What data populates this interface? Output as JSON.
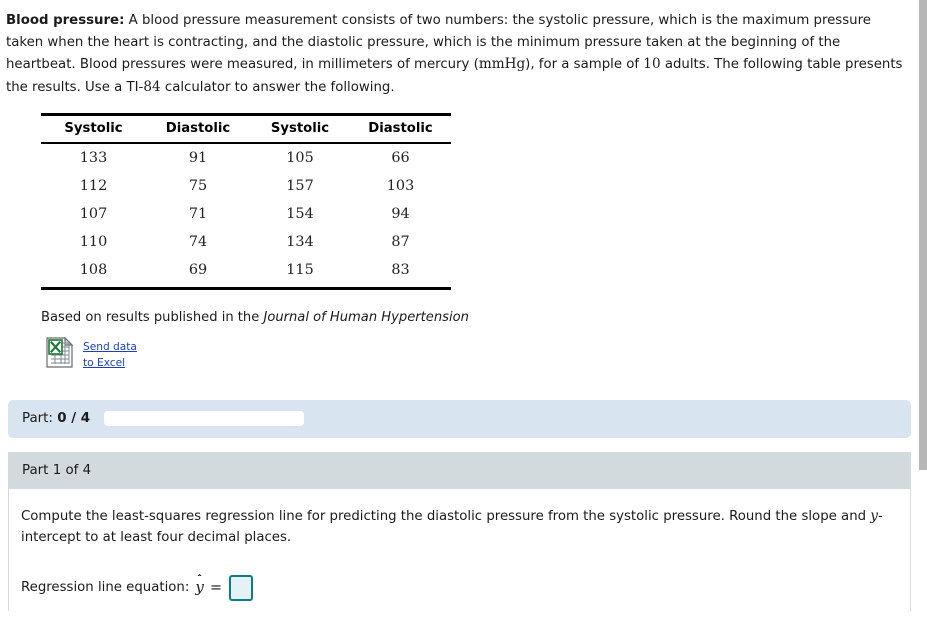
{
  "problem": {
    "lead_in": "Blood pressure:",
    "text_part1": " A blood pressure measurement consists of two numbers: the systolic pressure, which is the maximum pressure taken when the heart is contracting, and the diastolic pressure, which is the minimum pressure taken at the beginning of the heartbeat. Blood pressures were measured, in millimeters of mercury (",
    "unit": "mmHg",
    "text_part2": "), for a sample of ",
    "sample_size": "10",
    "text_part3": " adults. The following table presents the results. Use a TI-",
    "calculator_model": "84",
    "text_part4": " calculator to answer the following."
  },
  "table": {
    "headers": [
      "Systolic",
      "Diastolic",
      "Systolic",
      "Diastolic"
    ],
    "rows": [
      [
        "133",
        "91",
        "105",
        "66"
      ],
      [
        "112",
        "75",
        "157",
        "103"
      ],
      [
        "107",
        "71",
        "154",
        "94"
      ],
      [
        "110",
        "74",
        "134",
        "87"
      ],
      [
        "108",
        "69",
        "115",
        "83"
      ]
    ]
  },
  "source": {
    "prefix": "Based on results published in the ",
    "journal": "Journal of Human Hypertension"
  },
  "excel": {
    "icon": "excel-file-icon",
    "line1": "Send data",
    "line2": "to Excel"
  },
  "part_progress": {
    "label": "Part:",
    "value": "0 / 4",
    "progress_percent": 0
  },
  "part": {
    "header": "Part 1 of 4",
    "question_part1": "Compute the least-squares regression line for predicting the diastolic pressure from the systolic pressure. Round the slope and ",
    "question_variable": "y",
    "question_part2": "-intercept to at least four decimal places.",
    "answer_label": "Regression line equation:",
    "answer_variable": "y",
    "equals": "=",
    "input_value": "",
    "input_placeholder": ""
  },
  "colors": {
    "part_bar": "#d8e4ef",
    "part_header": "#d2dadd",
    "input_border": "#0b7c8c",
    "input_fill": "#e4f1f6",
    "link": "#1a3fc4",
    "excel_green": "#1f7a37"
  }
}
